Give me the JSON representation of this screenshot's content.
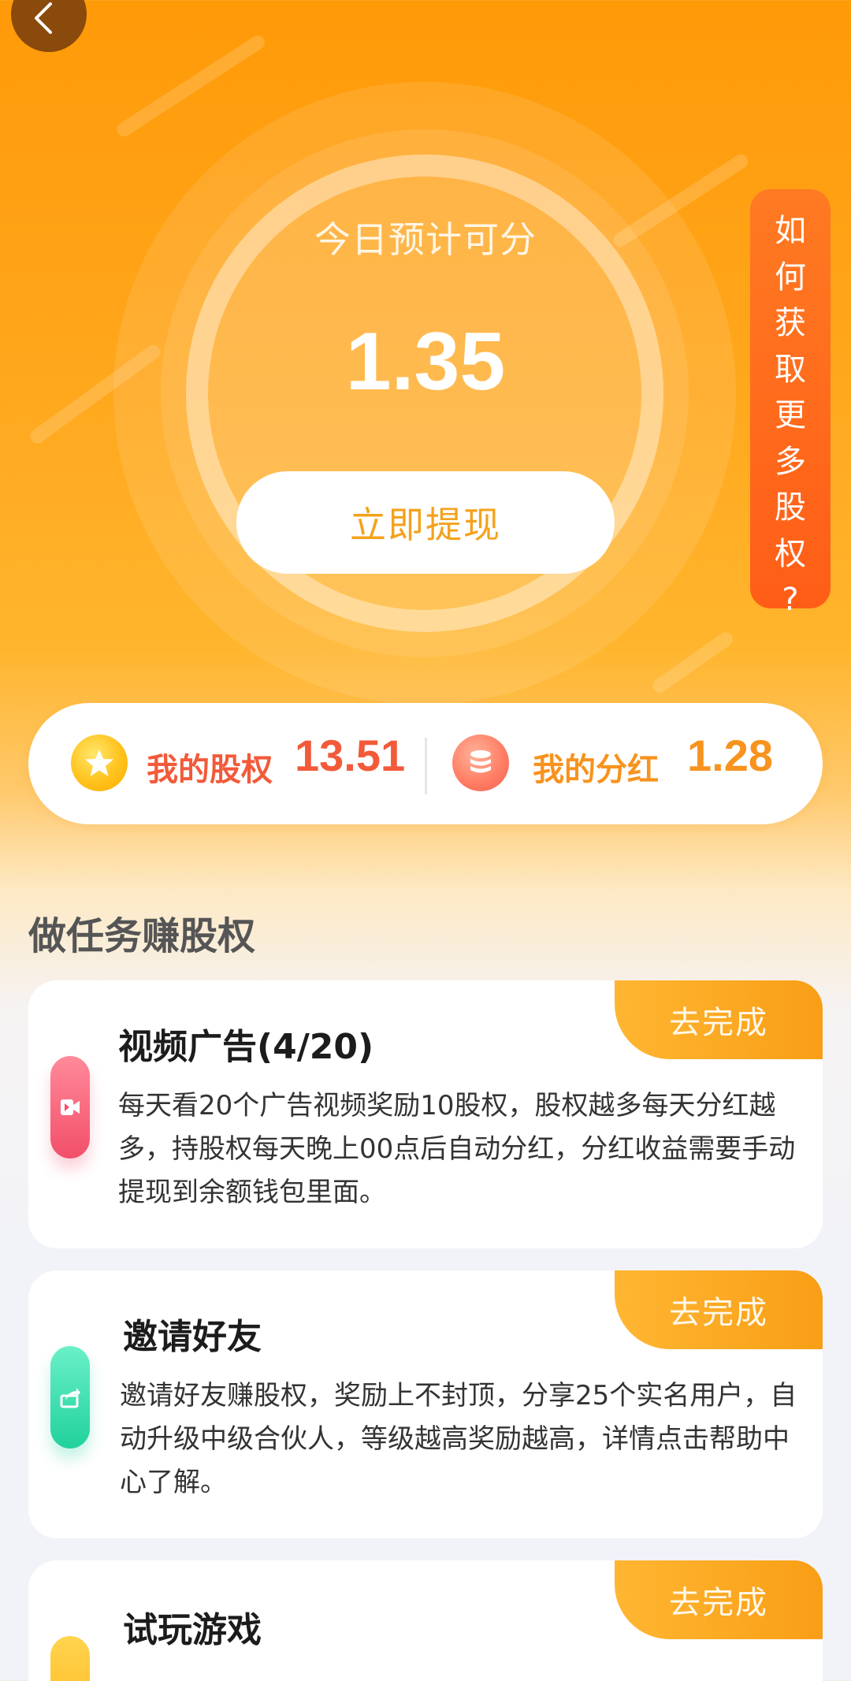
{
  "header": {
    "estimate_label": "今日预计可分",
    "estimate_value": "1.35",
    "withdraw_label": "立即提现",
    "side_tab_chars": [
      "如",
      "何",
      "获",
      "取",
      "更",
      "多",
      "股",
      "权",
      "?"
    ]
  },
  "summary": {
    "equity_label": "我的股权",
    "equity_value": "13.51",
    "dividend_label": "我的分红",
    "dividend_value": "1.28"
  },
  "section_title": "做任务赚股权",
  "tasks": [
    {
      "title": "视频广告(4/20)",
      "description": "每天看20个广告视频奖励10股权，股权越多每天分红越多，持股权每天晚上00点后自动分红，分红收益需要手动提现到余额钱包里面。",
      "action": "去完成",
      "icon": "video-icon"
    },
    {
      "title": "邀请好友",
      "description": "邀请好友赚股权，奖励上不封顶，分享25个实名用户，自动升级中级合伙人，等级越高奖励越高，详情点击帮助中心了解。",
      "action": "去完成",
      "icon": "share-icon"
    },
    {
      "title": "试玩游戏",
      "description": "",
      "action": "去完成",
      "icon": "game-icon"
    }
  ],
  "colors": {
    "accent_orange": "#f4a21b",
    "equity_red": "#f25a3a",
    "dividend_orange": "#f7931e"
  }
}
